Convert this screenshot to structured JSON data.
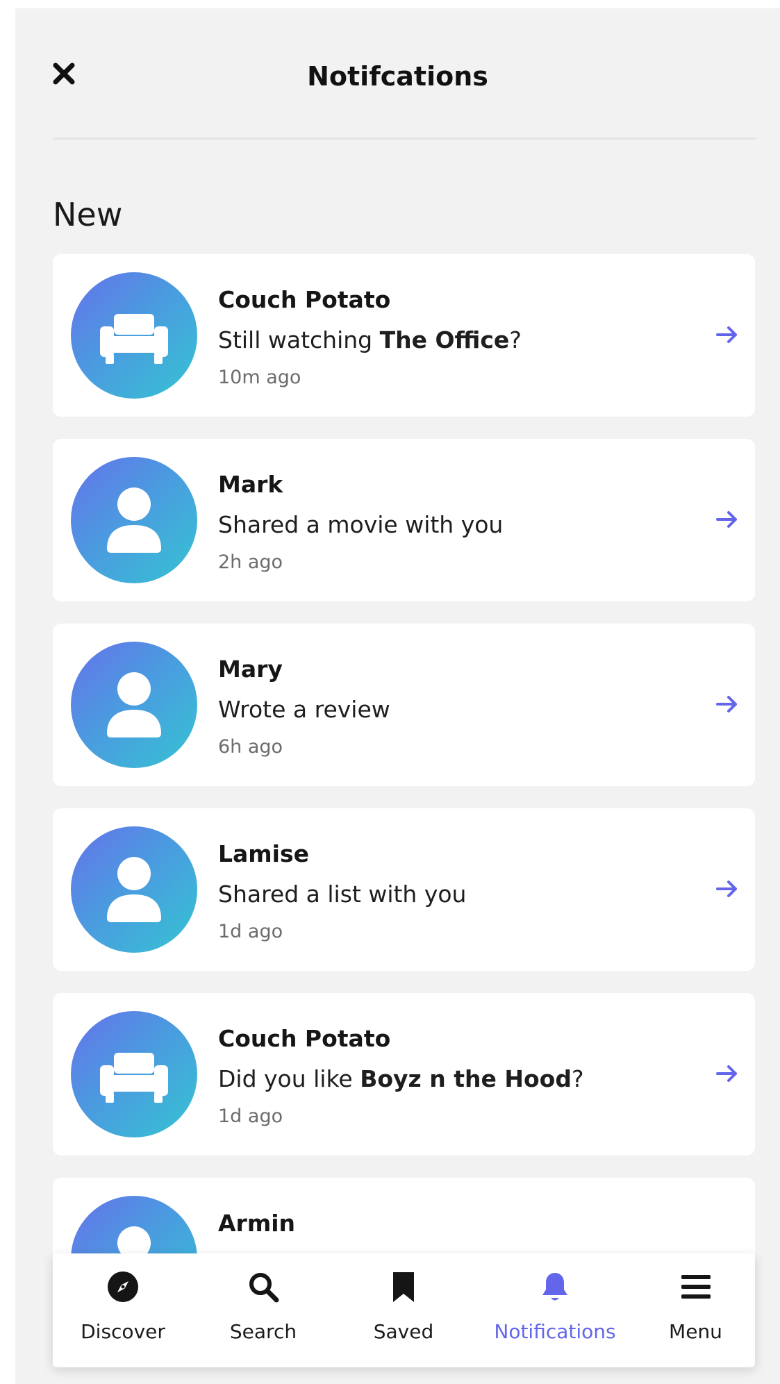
{
  "header": {
    "title": "Notifcations",
    "close_icon": "close-icon"
  },
  "section": {
    "title": "New"
  },
  "colors": {
    "accent": "#6366ea",
    "avatar_gradient_start": "#6672ea",
    "avatar_gradient_end": "#35c4d2",
    "background": "#f2f2f2"
  },
  "notifications": [
    {
      "name": "Couch Potato",
      "message_pre": "Still watching ",
      "message_bold": "The Office",
      "message_post": "?",
      "time": "10m ago",
      "icon": "couch-icon"
    },
    {
      "name": "Mark",
      "message_pre": "Shared a movie with you",
      "message_bold": "",
      "message_post": "",
      "time": "2h ago",
      "icon": "user-icon"
    },
    {
      "name": "Mary",
      "message_pre": "Wrote a review",
      "message_bold": "",
      "message_post": "",
      "time": "6h ago",
      "icon": "user-icon"
    },
    {
      "name": "Lamise",
      "message_pre": "Shared a list with you",
      "message_bold": "",
      "message_post": "",
      "time": "1d ago",
      "icon": "user-icon"
    },
    {
      "name": "Couch Potato",
      "message_pre": "Did you like ",
      "message_bold": "Boyz n the Hood",
      "message_post": "?",
      "time": "1d ago",
      "icon": "couch-icon"
    },
    {
      "name": "Armin",
      "message_pre": "",
      "message_bold": "",
      "message_post": "",
      "time": "",
      "icon": "user-icon"
    }
  ],
  "nav": {
    "items": [
      {
        "label": "Discover",
        "icon": "compass-icon",
        "active": false
      },
      {
        "label": "Search",
        "icon": "search-icon",
        "active": false
      },
      {
        "label": "Saved",
        "icon": "bookmark-icon",
        "active": false
      },
      {
        "label": "Notifications",
        "icon": "bell-icon",
        "active": true
      },
      {
        "label": "Menu",
        "icon": "menu-icon",
        "active": false
      }
    ]
  }
}
